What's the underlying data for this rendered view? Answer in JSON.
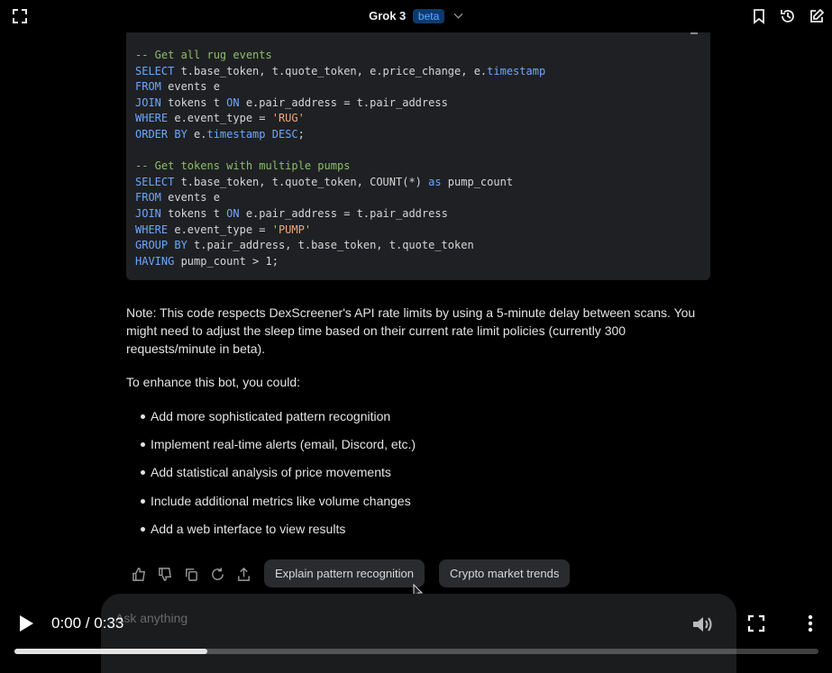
{
  "header": {
    "title": "Grok 3",
    "badge": "beta"
  },
  "code": {
    "lines": [
      [
        {
          "t": "-- Get all rug events",
          "c": "cm"
        }
      ],
      [
        {
          "t": "SELECT",
          "c": "kw"
        },
        {
          "t": " t.base_token, t.quote_token, e.price_change, e.",
          "c": ""
        },
        {
          "t": "timestamp",
          "c": "kw"
        }
      ],
      [
        {
          "t": "FROM",
          "c": "kw"
        },
        {
          "t": " events e",
          "c": ""
        }
      ],
      [
        {
          "t": "JOIN",
          "c": "kw"
        },
        {
          "t": " tokens t ",
          "c": ""
        },
        {
          "t": "ON",
          "c": "kw"
        },
        {
          "t": " e.pair_address = t.pair_address",
          "c": ""
        }
      ],
      [
        {
          "t": "WHERE",
          "c": "kw"
        },
        {
          "t": " e.event_type = ",
          "c": ""
        },
        {
          "t": "'RUG'",
          "c": "st"
        }
      ],
      [
        {
          "t": "ORDER BY",
          "c": "kw"
        },
        {
          "t": " e.",
          "c": ""
        },
        {
          "t": "timestamp",
          "c": "kw"
        },
        {
          "t": " ",
          "c": ""
        },
        {
          "t": "DESC",
          "c": "kw"
        },
        {
          "t": ";",
          "c": ""
        }
      ],
      [
        {
          "t": "",
          "c": ""
        }
      ],
      [
        {
          "t": "-- Get tokens with multiple pumps",
          "c": "cm"
        }
      ],
      [
        {
          "t": "SELECT",
          "c": "kw"
        },
        {
          "t": " t.base_token, t.quote_token, COUNT(*) ",
          "c": ""
        },
        {
          "t": "as",
          "c": "kw"
        },
        {
          "t": " pump_count",
          "c": ""
        }
      ],
      [
        {
          "t": "FROM",
          "c": "kw"
        },
        {
          "t": " events e",
          "c": ""
        }
      ],
      [
        {
          "t": "JOIN",
          "c": "kw"
        },
        {
          "t": " tokens t ",
          "c": ""
        },
        {
          "t": "ON",
          "c": "kw"
        },
        {
          "t": " e.pair_address = t.pair_address",
          "c": ""
        }
      ],
      [
        {
          "t": "WHERE",
          "c": "kw"
        },
        {
          "t": " e.event_type = ",
          "c": ""
        },
        {
          "t": "'PUMP'",
          "c": "st"
        }
      ],
      [
        {
          "t": "GROUP BY",
          "c": "kw"
        },
        {
          "t": " t.pair_address, t.base_token, t.quote_token",
          "c": ""
        }
      ],
      [
        {
          "t": "HAVING",
          "c": "kw"
        },
        {
          "t": " pump_count > 1;",
          "c": ""
        }
      ]
    ]
  },
  "response": {
    "note": "Note: This code respects DexScreener's API rate limits by using a 5-minute delay between scans. You might need to adjust the sleep time based on their current rate limit policies (currently 300 requests/minute in beta).",
    "enhance_intro": "To enhance this bot, you could:",
    "bullets": [
      "Add more sophisticated pattern recognition",
      "Implement real-time alerts (email, Discord, etc.)",
      "Add statistical analysis of price movements",
      "Include additional metrics like volume changes",
      "Add a web interface to view results"
    ]
  },
  "suggestions": {
    "one": "Explain pattern recognition",
    "two": "Crypto market trends"
  },
  "composer": {
    "placeholder": "Ask anything"
  },
  "video": {
    "time": "0:00 / 0:33",
    "progress_fraction": 0.24
  },
  "icons": [
    "expand-icon",
    "chevron-down-icon",
    "bookmark-icon",
    "history-icon",
    "edit-icon",
    "thumbs-up-icon",
    "thumbs-down-icon",
    "copy-icon",
    "regenerate-icon",
    "share-icon",
    "play-icon",
    "volume-icon",
    "fullscreen-icon",
    "more-vert-icon"
  ]
}
